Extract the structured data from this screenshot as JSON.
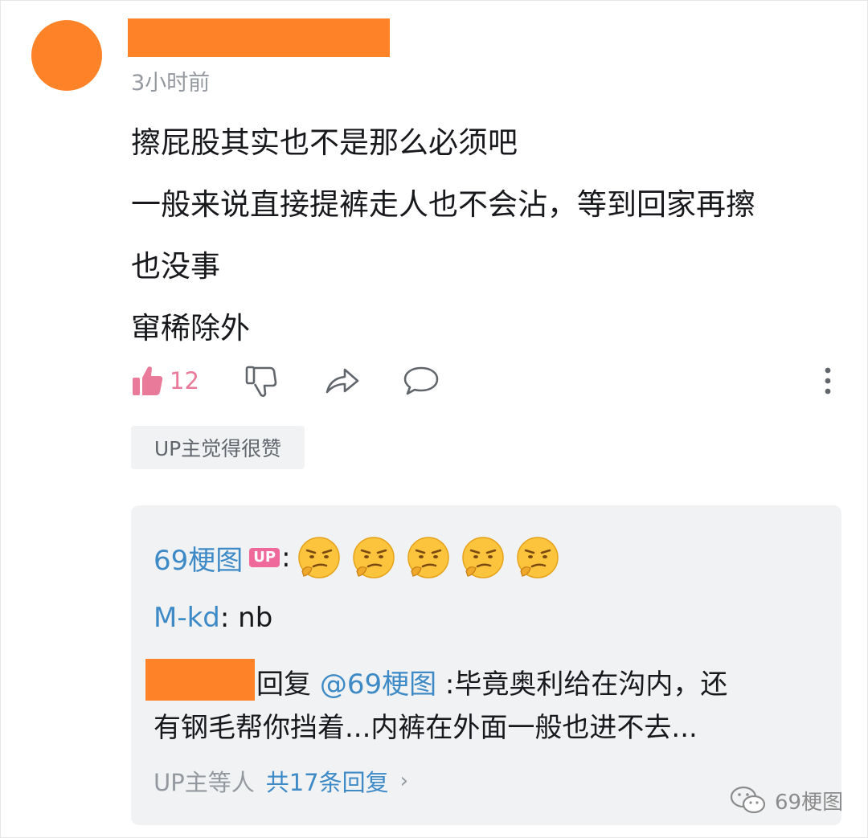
{
  "comment": {
    "time": "3小时前",
    "lines": [
      "擦屁股其实也不是那么必须吧",
      "一般来说直接提裤走人也不会沾，等到回家再擦",
      "也没事",
      "窜稀除外"
    ],
    "like_count": "12",
    "badge": "UP主觉得很赞"
  },
  "replies": {
    "first": {
      "user": "69梗图",
      "tag": "UP",
      "emoji_name": "smirk-emoji",
      "emoji_count": 5
    },
    "second": {
      "user": "M-kd",
      "text": "nb"
    },
    "third": {
      "reply_label": "回复",
      "mention": "@69梗图",
      "text_line1": ":毕竟奥利给在沟内，还",
      "text_line2": "有钢毛帮你挡着...内裤在外面一般也进不去..."
    },
    "more": {
      "prefix": "UP主等人",
      "total": "共17条回复",
      "chevron": "›"
    }
  },
  "watermark": {
    "text": "69梗图",
    "icon": "wechat-icon"
  },
  "colors": {
    "accent_orange": "#fd8228",
    "link_blue": "#3d8ac7",
    "like_pink": "#ea7a99",
    "up_tag": "#f0699b"
  }
}
